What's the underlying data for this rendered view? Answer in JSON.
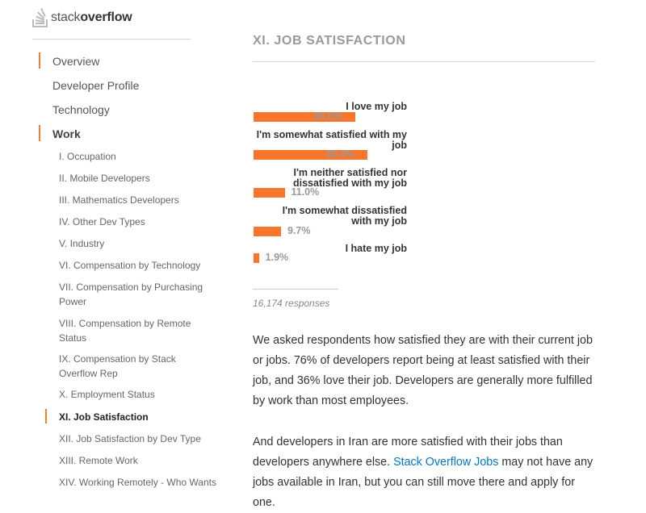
{
  "logo": {
    "text_light": "stack",
    "text_bold": "overflow"
  },
  "sidebar": {
    "items": [
      {
        "label": "Overview"
      },
      {
        "label": "Developer Profile"
      },
      {
        "label": "Technology"
      },
      {
        "label": "Work"
      }
    ],
    "work_subitems": [
      {
        "label": "I. Occupation"
      },
      {
        "label": "II. Mobile Developers"
      },
      {
        "label": "III. Mathematics Developers"
      },
      {
        "label": "IV. Other Dev Types"
      },
      {
        "label": "V. Industry"
      },
      {
        "label": "VI. Compensation by Technology"
      },
      {
        "label": "VII. Compensation by Purchasing Power"
      },
      {
        "label": "VIII. Compensation by Remote Status"
      },
      {
        "label": "IX. Compensation by Stack Overflow Rep"
      },
      {
        "label": "X. Employment Status"
      },
      {
        "label": "XI. Job Satisfaction"
      },
      {
        "label": "XII. Job Satisfaction by Dev Type"
      },
      {
        "label": "XIII. Remote Work"
      },
      {
        "label": "XIV. Working Remotely - Who Wants"
      }
    ]
  },
  "main": {
    "section_title": "XI. JOB SATISFACTION",
    "responses": "16,174 responses",
    "paragraph1": "We asked respondents how satisfied they are with their current job or jobs. 76% of developers report being at least satisfied with their job, and 36% love their job. Developers are generally more fulfilled by work than most employees.",
    "paragraph2_before": "And developers in Iran are more satisfied with their jobs than developers anywhere else. ",
    "paragraph2_link": "Stack Overflow Jobs",
    "paragraph2_after": " may not have any jobs available in Iran, but you can still move there and apply for one."
  },
  "colors": {
    "bar": "#f8762b",
    "accent": "#f48024",
    "link": "#0077cc"
  },
  "chart_data": {
    "type": "bar",
    "orientation": "horizontal",
    "categories": [
      "I love my job",
      "I'm somewhat satisfied with my job",
      "I'm neither satisfied nor dissatisfied with my job",
      "I'm somewhat dissatisfied with my job",
      "I hate my job"
    ],
    "values": [
      36.0,
      40.4,
      11.0,
      9.7,
      1.9
    ],
    "value_labels": [
      "36.0%",
      "40.4%",
      "11.0%",
      "9.7%",
      "1.9%"
    ],
    "title": "",
    "xlabel": "",
    "ylabel": "",
    "unit": "%"
  }
}
